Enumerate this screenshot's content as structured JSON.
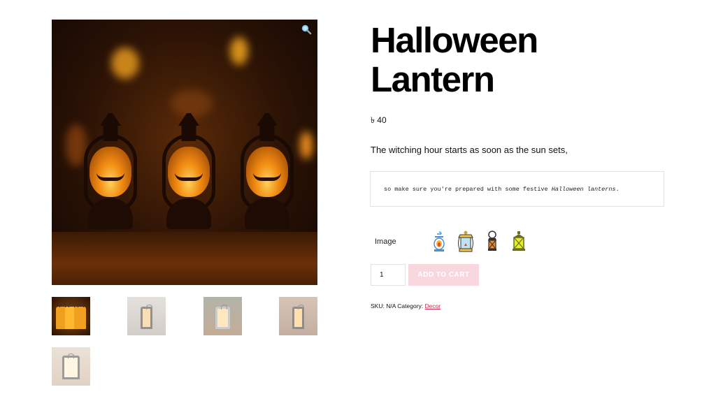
{
  "product": {
    "title_line1": "Halloween",
    "title_line2": "Lantern",
    "price": "৳ 40",
    "short_description": "The witching hour starts as soon as the sun sets,",
    "preformatted_prefix": "so make sure you're prepared with some festive ",
    "preformatted_emphasis": "Halloween lanterns",
    "preformatted_suffix": "."
  },
  "gallery": {
    "zoom_icon": "magnifier-icon",
    "main_image_alt": "Three jack-o'-lantern style lanterns glowing orange",
    "thumbnails": [
      {
        "name": "pumpkin lanterns",
        "active": true
      },
      {
        "name": "black lantern smoky",
        "active": false
      },
      {
        "name": "silver lantern on bench",
        "active": false
      },
      {
        "name": "lantern with candle",
        "active": false
      },
      {
        "name": "lantern on shelf",
        "active": false
      }
    ]
  },
  "variation": {
    "label": "Image",
    "options": [
      {
        "name": "blue oil lantern",
        "color": "#4a90d9"
      },
      {
        "name": "yellow lantern",
        "color": "#f2c94c"
      },
      {
        "name": "orange ring lantern",
        "color": "#f08a24"
      },
      {
        "name": "green lantern",
        "color": "#c8d82a"
      }
    ]
  },
  "cart": {
    "quantity": "1",
    "add_to_cart_label": "ADD TO CART"
  },
  "meta": {
    "sku_label": "SKU:",
    "sku_value": "N/A",
    "category_label": "Category:",
    "category_value": "Decor"
  },
  "colors": {
    "accent_link": "#d22a4e",
    "button_bg": "#f8d7df"
  }
}
